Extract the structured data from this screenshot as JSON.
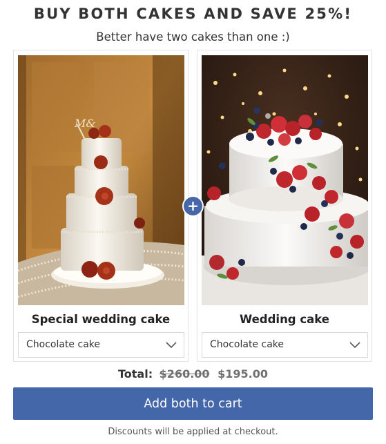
{
  "bundle": {
    "headline": "BUY BOTH CAKES AND SAVE 25%!",
    "subheadline": "Better have two cakes than one :)",
    "plus_symbol": "+",
    "products": [
      {
        "title": "Special wedding cake",
        "variant": "Chocolate cake",
        "photo_icon": "tiered-wedding-cake-photo"
      },
      {
        "title": "Wedding cake",
        "variant": "Chocolate cake",
        "photo_icon": "berry-cake-photo"
      }
    ],
    "total_label": "Total:",
    "price_original": "$260.00",
    "price_discounted": "$195.00",
    "add_button_label": "Add both to cart",
    "footnote": "Discounts will be applied at checkout."
  },
  "colors": {
    "accent": "#4467a9",
    "text": "#333333",
    "muted": "#6f6f6f",
    "border": "#e2e2e2"
  }
}
